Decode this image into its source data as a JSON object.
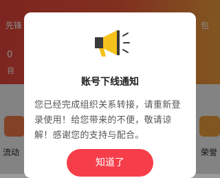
{
  "background": {
    "top_left_text": "先锋",
    "value_small": "0",
    "value_sub": "自",
    "left_label": "流动",
    "right_label": "荣誉",
    "right_top_text": "包"
  },
  "dialog": {
    "icon": "megaphone-icon",
    "title": "账号下线通知",
    "message": "您已经完成组织关系转接，请重新登录使用！给您带来的不便，敬请谅解！感谢您的支持与配合。",
    "ok_label": "知道了"
  },
  "colors": {
    "accent": "#f63e4a",
    "megaphone_yellow": "#f5c21b"
  }
}
